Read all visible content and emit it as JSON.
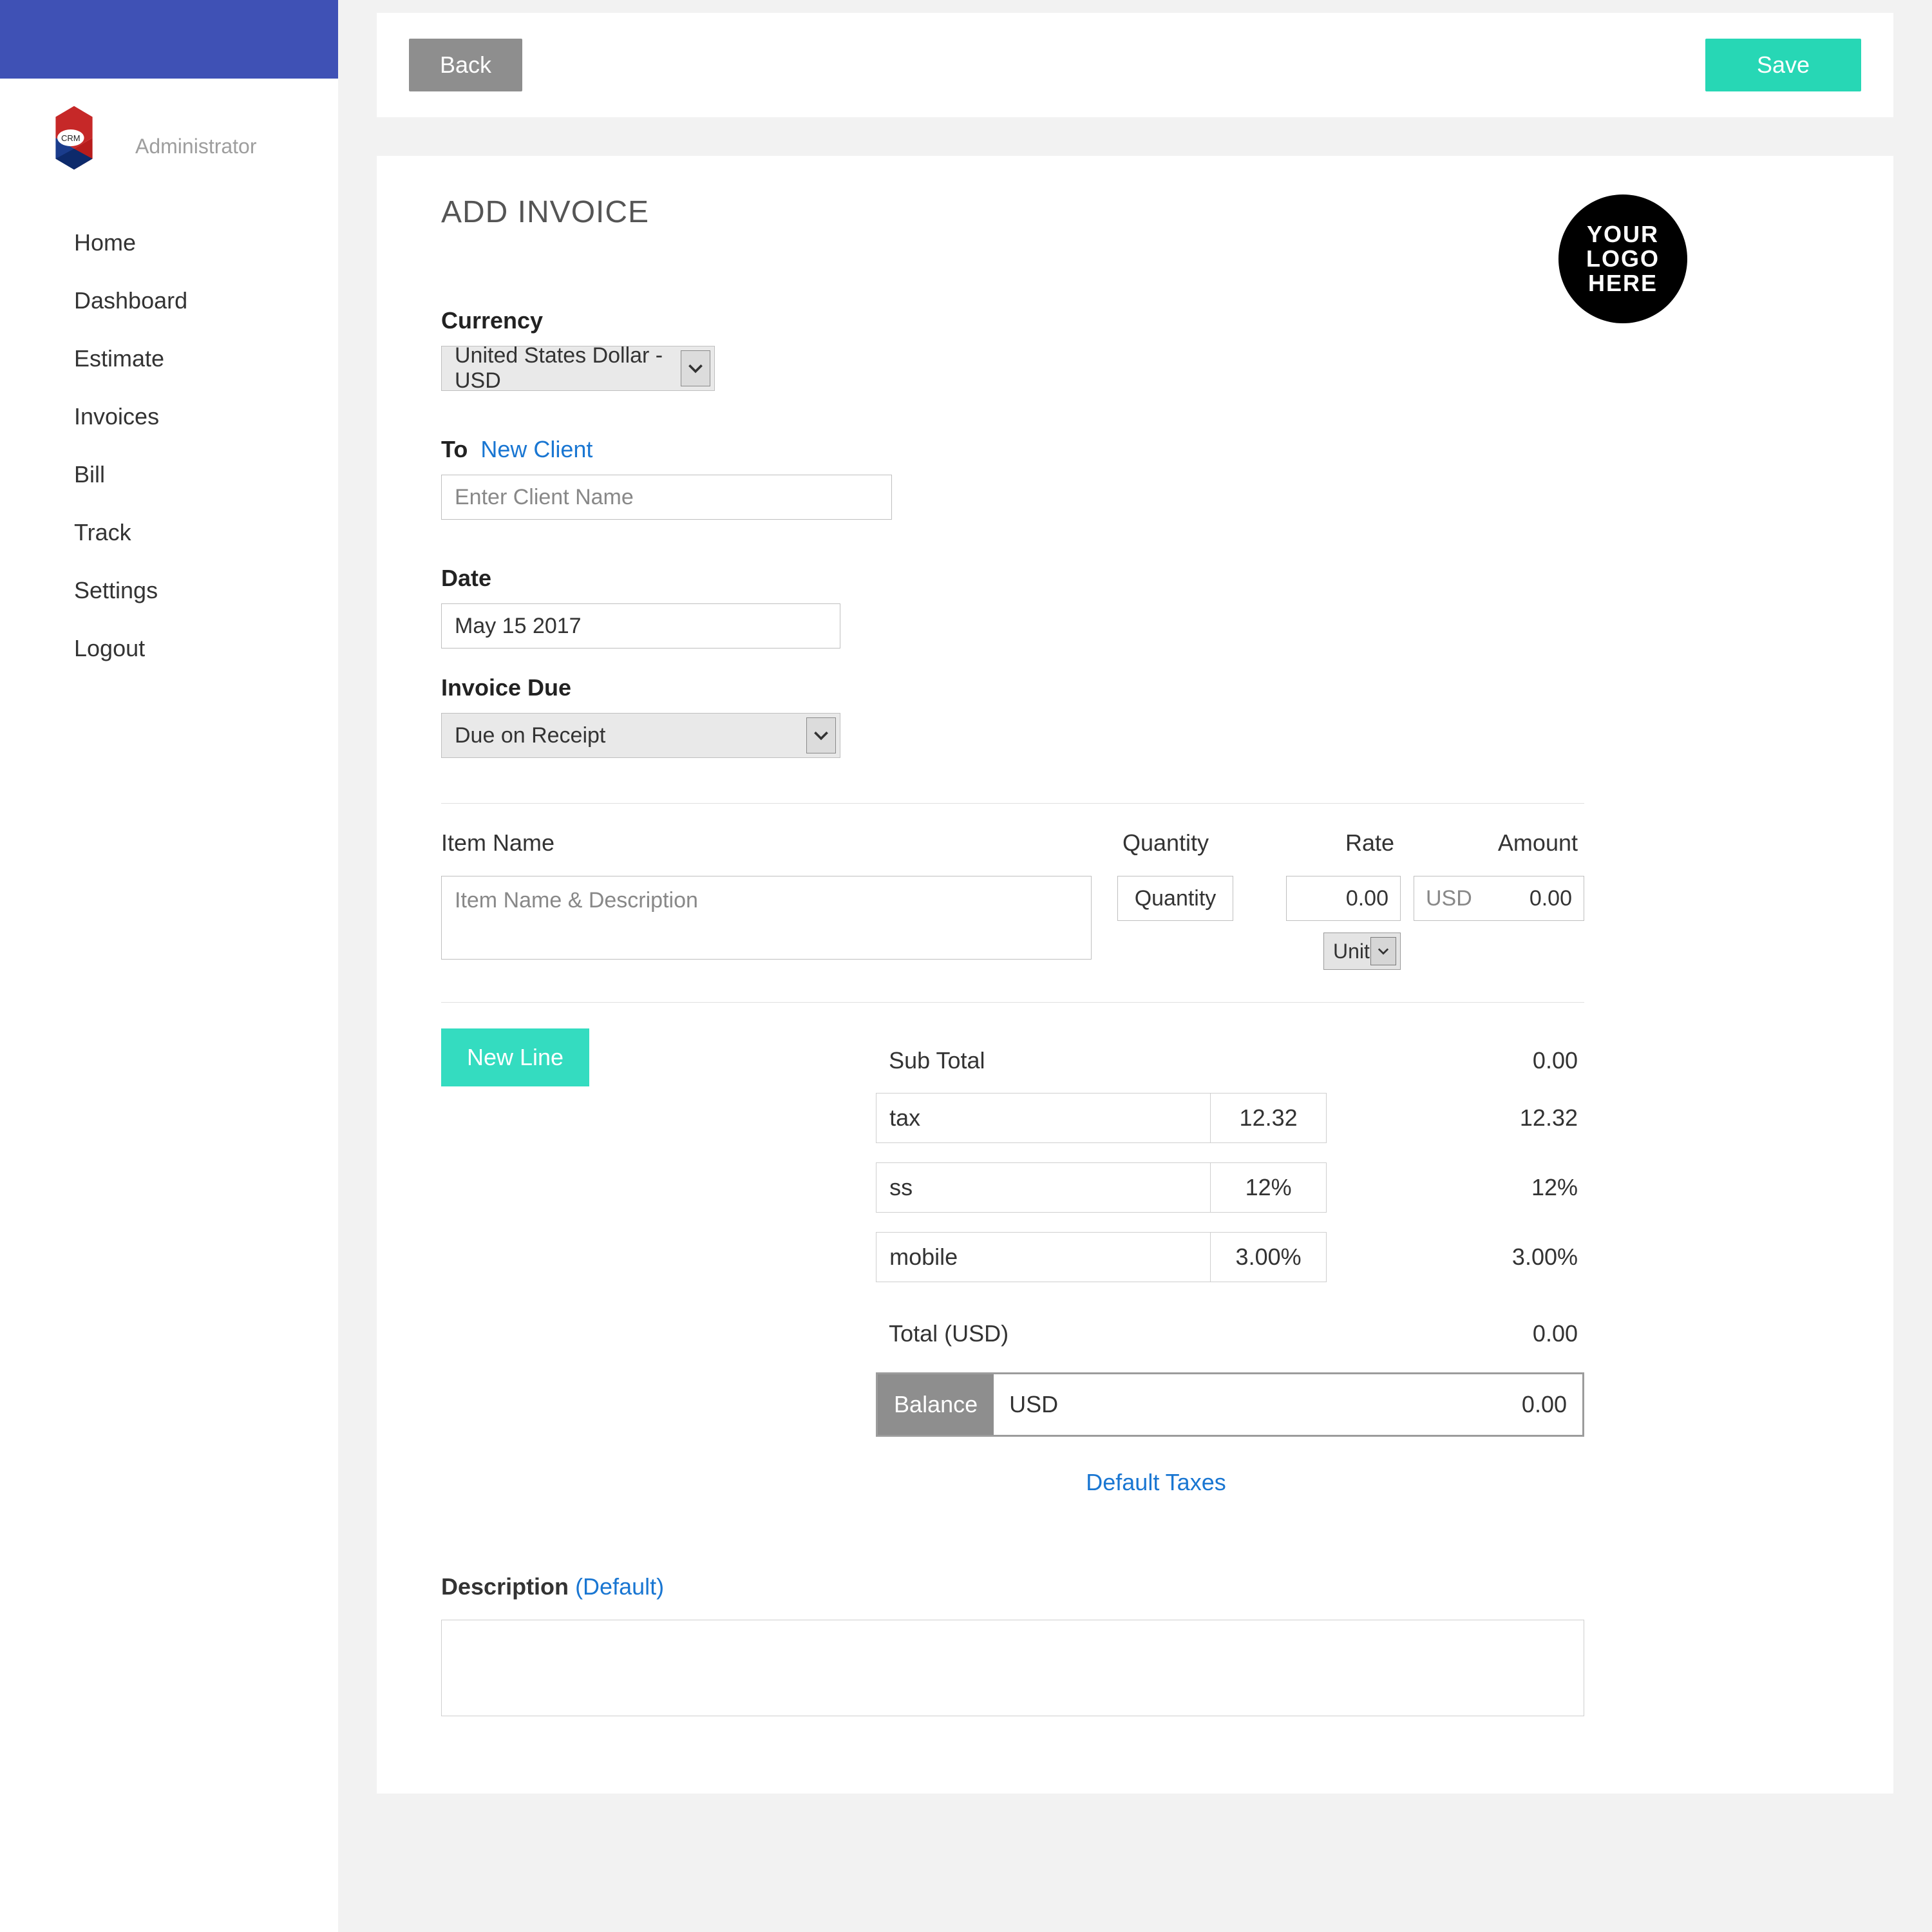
{
  "sidebar": {
    "role": "Administrator",
    "logo_text": "CRM",
    "items": [
      {
        "label": "Home"
      },
      {
        "label": "Dashboard"
      },
      {
        "label": "Estimate"
      },
      {
        "label": "Invoices"
      },
      {
        "label": "Bill"
      },
      {
        "label": "Track"
      },
      {
        "label": "Settings"
      },
      {
        "label": "Logout"
      }
    ]
  },
  "actions": {
    "back": "Back",
    "save": "Save"
  },
  "page": {
    "title": "ADD INVOICE",
    "logo_badge": {
      "l1": "YOUR",
      "l2": "LOGO",
      "l3": "HERE"
    }
  },
  "currency": {
    "label": "Currency",
    "selected": "United States Dollar - USD"
  },
  "to": {
    "label": "To",
    "new_client_link": "New Client",
    "placeholder": "Enter Client Name"
  },
  "date": {
    "label": "Date",
    "value": "May 15 2017"
  },
  "invoice_due": {
    "label": "Invoice Due",
    "selected": "Due on Receipt"
  },
  "line_items": {
    "headers": {
      "name": "Item Name",
      "qty": "Quantity",
      "rate": "Rate",
      "amount": "Amount"
    },
    "row": {
      "desc_placeholder": "Item Name & Description",
      "qty_placeholder": "Quantity",
      "rate_value": "0.00",
      "unit_label": "Unit",
      "amount_currency": "USD",
      "amount_value": "0.00"
    },
    "new_line": "New Line"
  },
  "totals": {
    "subtotal_label": "Sub Total",
    "subtotal_value": "0.00",
    "taxes": [
      {
        "name": "tax",
        "rate": "12.32",
        "amount": "12.32"
      },
      {
        "name": "ss",
        "rate": "12%",
        "amount": "12%"
      },
      {
        "name": "mobile",
        "rate": "3.00%",
        "amount": "3.00%"
      }
    ],
    "total_label": "Total (USD)",
    "total_value": "0.00",
    "balance_label": "Balance",
    "balance_currency": "USD",
    "balance_value": "0.00",
    "default_taxes_link": "Default Taxes"
  },
  "description": {
    "label": "Description",
    "paren": "(Default)"
  }
}
